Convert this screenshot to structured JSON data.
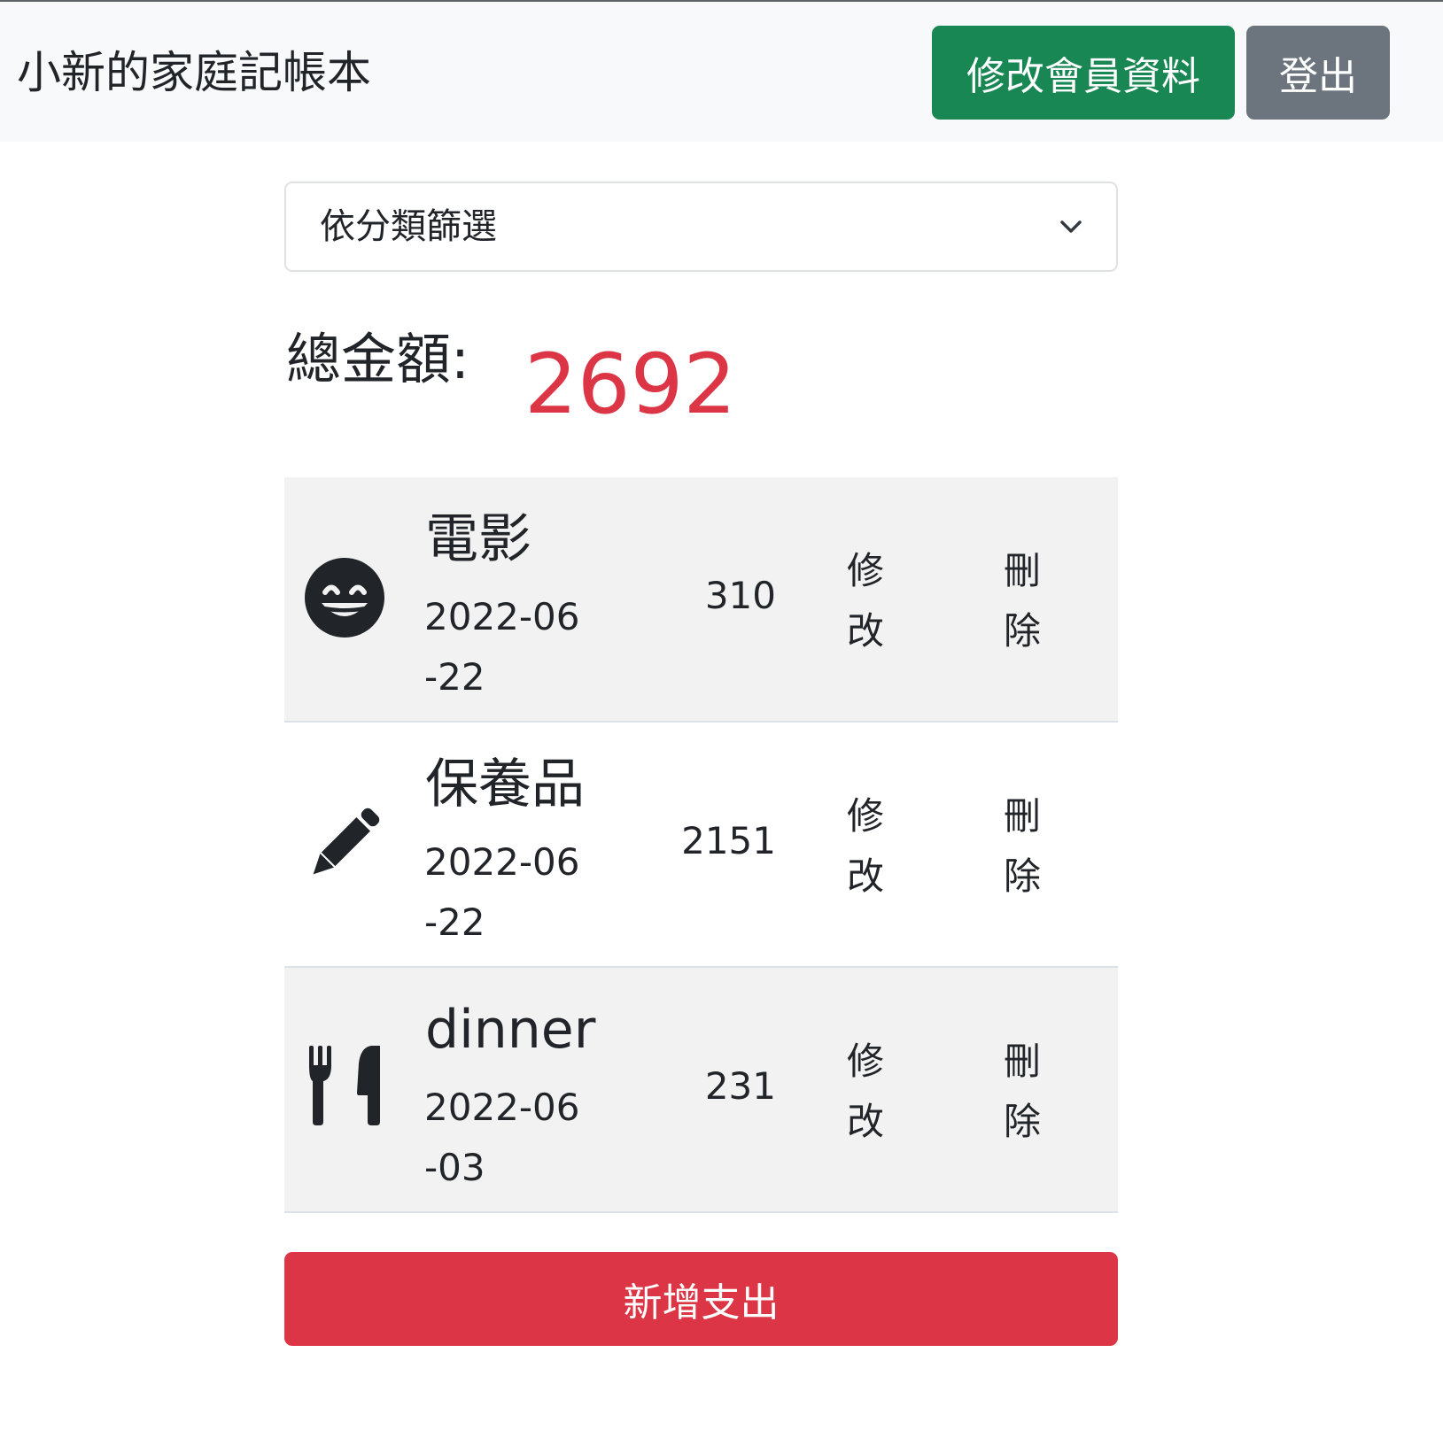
{
  "navbar": {
    "brand": "小新的家庭記帳本",
    "edit_profile_label": "修改會員資料",
    "logout_label": "登出",
    "edit_profile_color": "#198754",
    "logout_color": "#6c757d"
  },
  "filter": {
    "selected": "依分類篩選",
    "icon": "chevron-down-icon"
  },
  "total": {
    "label": "總金額:",
    "value": "2692",
    "value_color": "#dc3545"
  },
  "expenses": [
    {
      "icon": "grin-face-icon",
      "name": "電影",
      "date": "2022-06-22",
      "amount": "310",
      "edit_label": "修改",
      "delete_label": "刪除"
    },
    {
      "icon": "pencil-icon",
      "name": "保養品",
      "date": "2022-06-22",
      "amount": "2151",
      "edit_label": "修改",
      "delete_label": "刪除"
    },
    {
      "icon": "utensils-icon",
      "name": "dinner",
      "date": "2022-06-03",
      "amount": "231",
      "edit_label": "修改",
      "delete_label": "刪除"
    }
  ],
  "add_button": {
    "label": "新增支出",
    "color": "#dc3545"
  }
}
